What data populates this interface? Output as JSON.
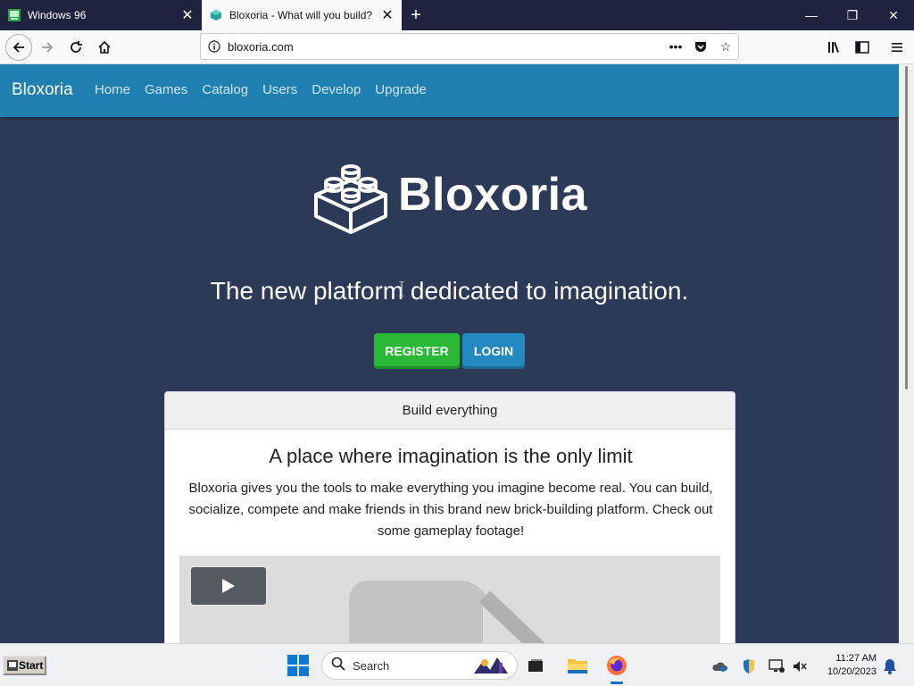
{
  "browser": {
    "tabs": [
      {
        "title": "Windows 96",
        "active": false
      },
      {
        "title": "Bloxoria - What will you build?",
        "active": true
      }
    ],
    "url": "bloxoria.com"
  },
  "site": {
    "brand": "Bloxoria",
    "nav": [
      "Home",
      "Games",
      "Catalog",
      "Users",
      "Develop",
      "Upgrade"
    ],
    "logo_text": "Bloxoria",
    "tagline": "The new platform dedicated to imagination.",
    "register_label": "REGISTER",
    "login_label": "LOGIN",
    "card": {
      "header": "Build everything",
      "title": "A place where imagination is the only limit",
      "text": "Bloxoria gives you the tools to make everything you imagine become real. You can build, socialize, compete and make friends in this brand new brick-building platform. Check out some gameplay footage!"
    },
    "colors": {
      "nav_bg": "#1f7fb0",
      "page_bg": "#2c3a58",
      "register": "#2ab837",
      "login": "#2489c0"
    }
  },
  "taskbar": {
    "start_label": "Start",
    "search_placeholder": "Search",
    "time": "11:27 AM",
    "date": "10/20/2023"
  }
}
